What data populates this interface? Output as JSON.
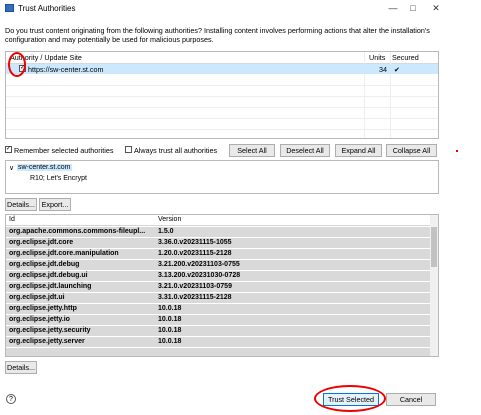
{
  "window": {
    "title": "Trust Authorities",
    "minimize_glyph": "—",
    "maximize_glyph": "□",
    "close_glyph": "✕"
  },
  "intro_text": "Do you trust content originating from the following authorities? Installing content involves performing actions that alter the installation's configuration and may potentially be used for malicious purposes.",
  "authorities_table": {
    "headers": {
      "site": "Authority / Update Site",
      "units": "Units",
      "secured": "Secured"
    },
    "rows": [
      {
        "checked": true,
        "site": "https://sw-center.st.com",
        "units": "34",
        "secured": "✔"
      }
    ]
  },
  "controls": {
    "remember_label": "Remember selected authorities",
    "remember_checked": true,
    "always_trust_label": "Always trust all authorities",
    "always_trust_checked": false,
    "select_all": "Select All",
    "deselect_all": "Deselect All",
    "expand_all": "Expand All",
    "collapse_all": "Collapse All"
  },
  "certificate": {
    "expander": "∨",
    "issuer": "sw-center.st.com",
    "chain_item": "R10; Let's Encrypt"
  },
  "details_button_1": "Details...",
  "export_button": "Export...",
  "units_table": {
    "headers": {
      "id": "Id",
      "version": "Version"
    },
    "rows": [
      {
        "id": "org.apache.commons.commons-fileupl...",
        "version": "1.5.0"
      },
      {
        "id": "org.eclipse.jdt.core",
        "version": "3.36.0.v20231115-1055"
      },
      {
        "id": "org.eclipse.jdt.core.manipulation",
        "version": "1.20.0.v20231115-2128"
      },
      {
        "id": "org.eclipse.jdt.debug",
        "version": "3.21.200.v20231103-0755"
      },
      {
        "id": "org.eclipse.jdt.debug.ui",
        "version": "3.13.200.v20231030-0728"
      },
      {
        "id": "org.eclipse.jdt.launching",
        "version": "3.21.0.v20231103-0759"
      },
      {
        "id": "org.eclipse.jdt.ui",
        "version": "3.31.0.v20231115-2128"
      },
      {
        "id": "org.eclipse.jetty.http",
        "version": "10.0.18"
      },
      {
        "id": "org.eclipse.jetty.io",
        "version": "10.0.18"
      },
      {
        "id": "org.eclipse.jetty.security",
        "version": "10.0.18"
      },
      {
        "id": "org.eclipse.jetty.server",
        "version": "10.0.18"
      }
    ]
  },
  "details_button_2": "Details...",
  "help_glyph": "?",
  "trust_selected_button": "Trust Selected",
  "cancel_button": "Cancel",
  "colors": {
    "selection": "#cce8ff",
    "annotation": "#e00000",
    "default_button_border": "#0078d7"
  }
}
